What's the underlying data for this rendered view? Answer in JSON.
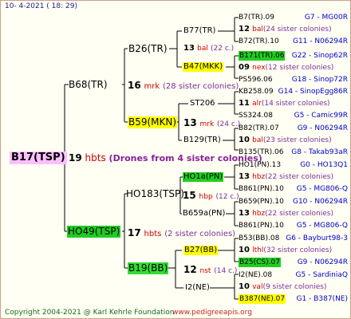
{
  "header": {
    "date": "10-   4-2021  ( 18:  29)"
  },
  "root": {
    "label": "B17(TSP)",
    "num": "19",
    "code": "hbts",
    "drones": "(Drones from 4 sister colonies)"
  },
  "gen1": {
    "top": {
      "label": "B68(TR)",
      "num": "16",
      "code": "mrk",
      "sis": "(28 sister colonies)"
    },
    "bottom": {
      "label": "HO49(TSP)",
      "num": "17",
      "code": "hbts",
      "sis": "(2 sister colonies)"
    }
  },
  "gen2": {
    "a": {
      "label": "B26(TR)"
    },
    "b": {
      "label": "B59(MKN)",
      "num": "13",
      "code": "mrk",
      "sis": "(24 c.)"
    },
    "c": {
      "label": "HO183(TSP)",
      "num": "15",
      "code": "hbp",
      "sis": "(12 c.)"
    },
    "d": {
      "label": "B19(BB)",
      "num": "12",
      "code": "nst",
      "sis": "(14 c.)"
    }
  },
  "gen3": {
    "a1": {
      "label": "B77(TR)",
      "num": "13",
      "code": "bal",
      "sis": "(22 c.)"
    },
    "a2": {
      "label": "B47(MKK)"
    },
    "b1": {
      "label": "ST206"
    },
    "b2": {
      "label": "B129(TR)"
    },
    "c1": {
      "label": "HO1a(PN)"
    },
    "c2": {
      "label": "B659a(PN)"
    },
    "d1": {
      "label": "B27(BB)"
    },
    "d2": {
      "label": "I2(NE)"
    }
  },
  "gen4": [
    {
      "label": "B7(TR).09",
      "info": "G7 - MG00R"
    },
    {
      "num": "12",
      "code": "bal",
      "sis": "(24 sister colonies)"
    },
    {
      "label": "B72(TR).10",
      "info": "G11 - N06294R"
    },
    {
      "label": "B171(TR).06",
      "info": "G22 - Sinop62R"
    },
    {
      "num": "09",
      "code": "nex",
      "sis": "(12 sister colonies)"
    },
    {
      "label": "PS596.06",
      "info": "G18 - Sinop72R"
    },
    {
      "label": "KB258.09",
      "info": "G14 - SinopEgg86R"
    },
    {
      "num": "11",
      "code": "alr",
      "sis": "(14 sister colonies)"
    },
    {
      "label": "SS324.08",
      "info": "G5 - Camic99R"
    },
    {
      "label": "B82(TR).07",
      "info": "G9 - N06294R"
    },
    {
      "num": "10",
      "code": "bal",
      "sis": "(23 sister colonies)"
    },
    {
      "label": "B135(TR).06",
      "info": "G8 - Takab93aR"
    },
    {
      "label": "HO1(PN).13",
      "info": "G0 - HO13Q1"
    },
    {
      "num": "13",
      "code": "hbz",
      "sis": "(22 sister colonies)"
    },
    {
      "label": "B861(PN).10",
      "info": "G5 - MG806-Q"
    },
    {
      "label": "B659(PN).10",
      "info": "G10 - N06294R"
    },
    {
      "num": "13",
      "code": "hbz",
      "sis": "(22 sister colonies)"
    },
    {
      "label": "B861(PN).10",
      "info": "G5 - MG806-Q"
    },
    {
      "label": "B53(BB).08",
      "info": "G6 - Bayburt98-3"
    },
    {
      "num": "10",
      "code": "lthl",
      "sis": "(32 sister colonies)"
    },
    {
      "label": "B25(CS).07",
      "info": "G9 - N06294R"
    },
    {
      "label": "I2(NE).08",
      "info": "G5 - SardiniaQ"
    },
    {
      "num": "10",
      "code": "val",
      "sis": "(9 sister colonies)"
    },
    {
      "label": "B387(NE).07",
      "info": "G1 - B387(NE)"
    }
  ],
  "footer": {
    "copyright": "Copyright 2004-2021 @ Karl Kehrle Foundation",
    "site": "www.pedigreeapis.org"
  },
  "colors": {
    "root_bg": "#ffc0ff",
    "green_bg": "#22cc22",
    "yellow_bg": "#ffff00",
    "line": "#000000"
  }
}
